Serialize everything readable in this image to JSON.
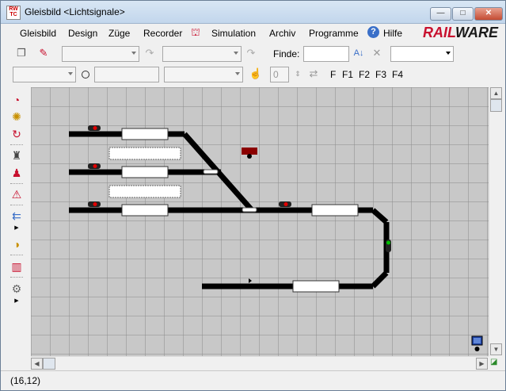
{
  "window": {
    "title": "Gleisbild <Lichtsignale>",
    "controls": {
      "minimize": "—",
      "maximize": "□",
      "close": "✕"
    }
  },
  "menu": {
    "items": [
      "Gleisbild",
      "Design",
      "Züge",
      "Recorder",
      "Simulation",
      "Archiv",
      "Programme",
      "Hilfe"
    ],
    "brand_red": "RAIL",
    "brand_dark": "WARE"
  },
  "toolbar1": {
    "find_label": "Finde:",
    "find_value": ""
  },
  "toolbar2": {
    "counter_value": "0",
    "function_keys": [
      "F",
      "F1",
      "F2",
      "F3",
      "F4"
    ]
  },
  "status": {
    "coords": "(16,12)"
  },
  "colors": {
    "accent": "#c8102e",
    "track": "#000000",
    "grid_bg": "#c8c8c8",
    "grid_line": "#8a8a8a",
    "signal_red": "#e00000",
    "signal_green": "#00c000",
    "occupied": "#8b0000"
  },
  "left_toolbar_icons": [
    "route-icon",
    "gear-train-icon",
    "refresh-icon",
    "locomotive-icon",
    "signal-person-icon",
    "crossing-icon",
    "arrow-stack-icon",
    "circle-tools-icon",
    "graph-icon",
    "cog-icon"
  ],
  "layout": {
    "track_label_boxes": 6
  }
}
